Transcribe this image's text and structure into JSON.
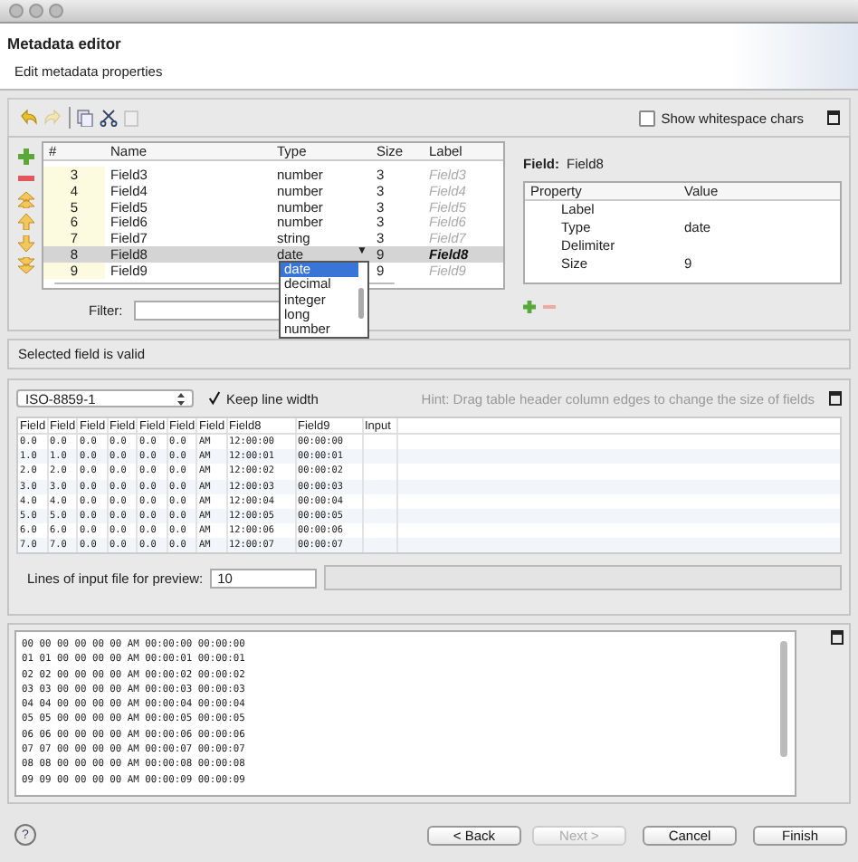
{
  "header": {
    "title": "Metadata editor",
    "subtitle": "Edit metadata properties"
  },
  "toolbar": {
    "show_whitespace": {
      "label": "Show whitespace chars",
      "checked": false
    }
  },
  "fields_table": {
    "columns": [
      "#",
      "Name",
      "Type",
      "Size",
      "Label"
    ],
    "rows": [
      {
        "number": "3",
        "name": "Field3",
        "type": "number",
        "size": "3",
        "label": "Field3",
        "selected": false
      },
      {
        "number": "4",
        "name": "Field4",
        "type": "number",
        "size": "3",
        "label": "Field4",
        "selected": false
      },
      {
        "number": "5",
        "name": "Field5",
        "type": "number",
        "size": "3",
        "label": "Field5",
        "selected": false
      },
      {
        "number": "6",
        "name": "Field6",
        "type": "number",
        "size": "3",
        "label": "Field6",
        "selected": false
      },
      {
        "number": "7",
        "name": "Field7",
        "type": "string",
        "size": "3",
        "label": "Field7",
        "selected": false
      },
      {
        "number": "8",
        "name": "Field8",
        "type": "date",
        "size": "9",
        "label": "Field8",
        "selected": true
      },
      {
        "number": "9",
        "name": "Field9",
        "type": "",
        "size": "9",
        "label": "Field9",
        "selected": false
      }
    ],
    "type_dropdown": {
      "arrow": "▼",
      "options": [
        {
          "label": "date",
          "selected": true
        },
        {
          "label": "decimal",
          "selected": false
        },
        {
          "label": "integer",
          "selected": false
        },
        {
          "label": "long",
          "selected": false
        },
        {
          "label": "number",
          "selected": false
        }
      ]
    },
    "filter_label": "Filter:"
  },
  "field_panel": {
    "label": "Field:",
    "value": "Field8",
    "columns": [
      "Property",
      "Value"
    ],
    "rows": [
      {
        "property": "Label",
        "value": ""
      },
      {
        "property": "Type",
        "value": "date"
      },
      {
        "property": "Delimiter",
        "value": ""
      },
      {
        "property": "Size",
        "value": "9"
      }
    ]
  },
  "status": "Selected field is valid",
  "preview": {
    "charset": "ISO-8859-1",
    "keep_line_width": {
      "label": "Keep line width",
      "checked": true
    },
    "hint": "Hint: Drag table header column edges to change the size of fields",
    "columns": [
      "Field",
      "Field",
      "Field",
      "Field",
      "Field",
      "Field",
      "Field",
      "Field8",
      "Field9",
      "Input"
    ],
    "rows": [
      [
        "0.0",
        "0.0",
        "0.0",
        "0.0",
        "0.0",
        "0.0",
        "AM",
        "12:00:00",
        "00:00:00"
      ],
      [
        "1.0",
        "1.0",
        "0.0",
        "0.0",
        "0.0",
        "0.0",
        "AM",
        "12:00:01",
        "00:00:01"
      ],
      [
        "2.0",
        "2.0",
        "0.0",
        "0.0",
        "0.0",
        "0.0",
        "AM",
        "12:00:02",
        "00:00:02"
      ],
      [
        "3.0",
        "3.0",
        "0.0",
        "0.0",
        "0.0",
        "0.0",
        "AM",
        "12:00:03",
        "00:00:03"
      ],
      [
        "4.0",
        "4.0",
        "0.0",
        "0.0",
        "0.0",
        "0.0",
        "AM",
        "12:00:04",
        "00:00:04"
      ],
      [
        "5.0",
        "5.0",
        "0.0",
        "0.0",
        "0.0",
        "0.0",
        "AM",
        "12:00:05",
        "00:00:05"
      ],
      [
        "6.0",
        "6.0",
        "0.0",
        "0.0",
        "0.0",
        "0.0",
        "AM",
        "12:00:06",
        "00:00:06"
      ],
      [
        "7.0",
        "7.0",
        "0.0",
        "0.0",
        "0.0",
        "0.0",
        "AM",
        "12:00:07",
        "00:00:07"
      ]
    ],
    "lines_label": "Lines of input file for preview:",
    "lines_value": "10"
  },
  "raw_preview": {
    "lines": [
      "00 00 00 00 00 00 AM 00:00:00 00:00:00",
      "01 01 00 00 00 00 AM 00:00:01 00:00:01",
      "02 02 00 00 00 00 AM 00:00:02 00:00:02",
      "03 03 00 00 00 00 AM 00:00:03 00:00:03",
      "04 04 00 00 00 00 AM 00:00:04 00:00:04",
      "05 05 00 00 00 00 AM 00:00:05 00:00:05",
      "06 06 00 00 00 00 AM 00:00:06 00:00:06",
      "07 07 00 00 00 00 AM 00:00:07 00:00:07",
      "08 08 00 00 00 00 AM 00:00:08 00:00:08",
      "09 09 00 00 00 00 AM 00:00:09 00:00:09"
    ]
  },
  "help": "?",
  "buttons": [
    {
      "label": "< Back",
      "disabled": false
    },
    {
      "label": "Next >",
      "disabled": true
    },
    {
      "label": "Cancel",
      "disabled": false
    },
    {
      "label": "Finish",
      "disabled": false
    }
  ]
}
